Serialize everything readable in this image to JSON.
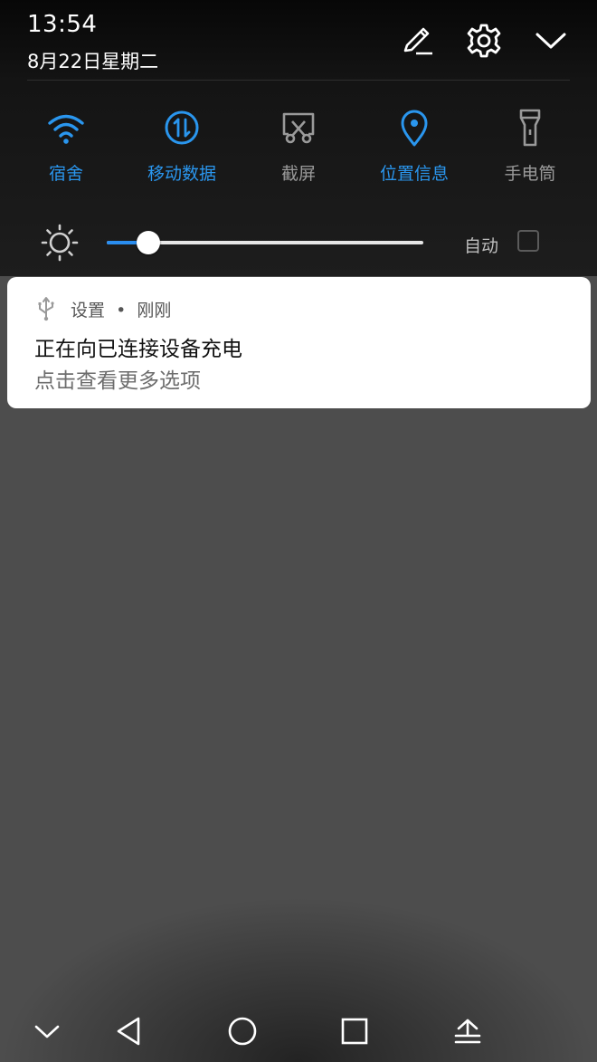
{
  "status": {
    "time": "13:54",
    "date": "8月22日星期二"
  },
  "header_icons": [
    {
      "name": "edit-icon"
    },
    {
      "name": "settings-icon"
    },
    {
      "name": "collapse-chevron-icon"
    }
  ],
  "quick_tiles": [
    {
      "label": "宿舍",
      "icon": "wifi-icon",
      "active": true
    },
    {
      "label": "移动数据",
      "icon": "mobile-data-icon",
      "active": true
    },
    {
      "label": "截屏",
      "icon": "screenshot-icon",
      "active": false
    },
    {
      "label": "位置信息",
      "icon": "location-icon",
      "active": true
    },
    {
      "label": "手电筒",
      "icon": "flashlight-icon",
      "active": false
    }
  ],
  "brightness": {
    "level_percent": 13,
    "auto_label": "自动",
    "auto_checked": false
  },
  "notification": {
    "icon": "usb-icon",
    "app": "设置",
    "separator": "•",
    "when": "刚刚",
    "title": "正在向已连接设备充电",
    "text": "点击查看更多选项"
  },
  "nav_bar": [
    {
      "name": "hide-nav-icon"
    },
    {
      "name": "back-icon"
    },
    {
      "name": "home-icon"
    },
    {
      "name": "recents-icon"
    },
    {
      "name": "notification-shade-icon"
    }
  ],
  "colors": {
    "accent": "#2a96ee",
    "inactive": "#9a9a9a",
    "shade_bg": "#1d1d1d",
    "backdrop": "#4d4d4d"
  }
}
